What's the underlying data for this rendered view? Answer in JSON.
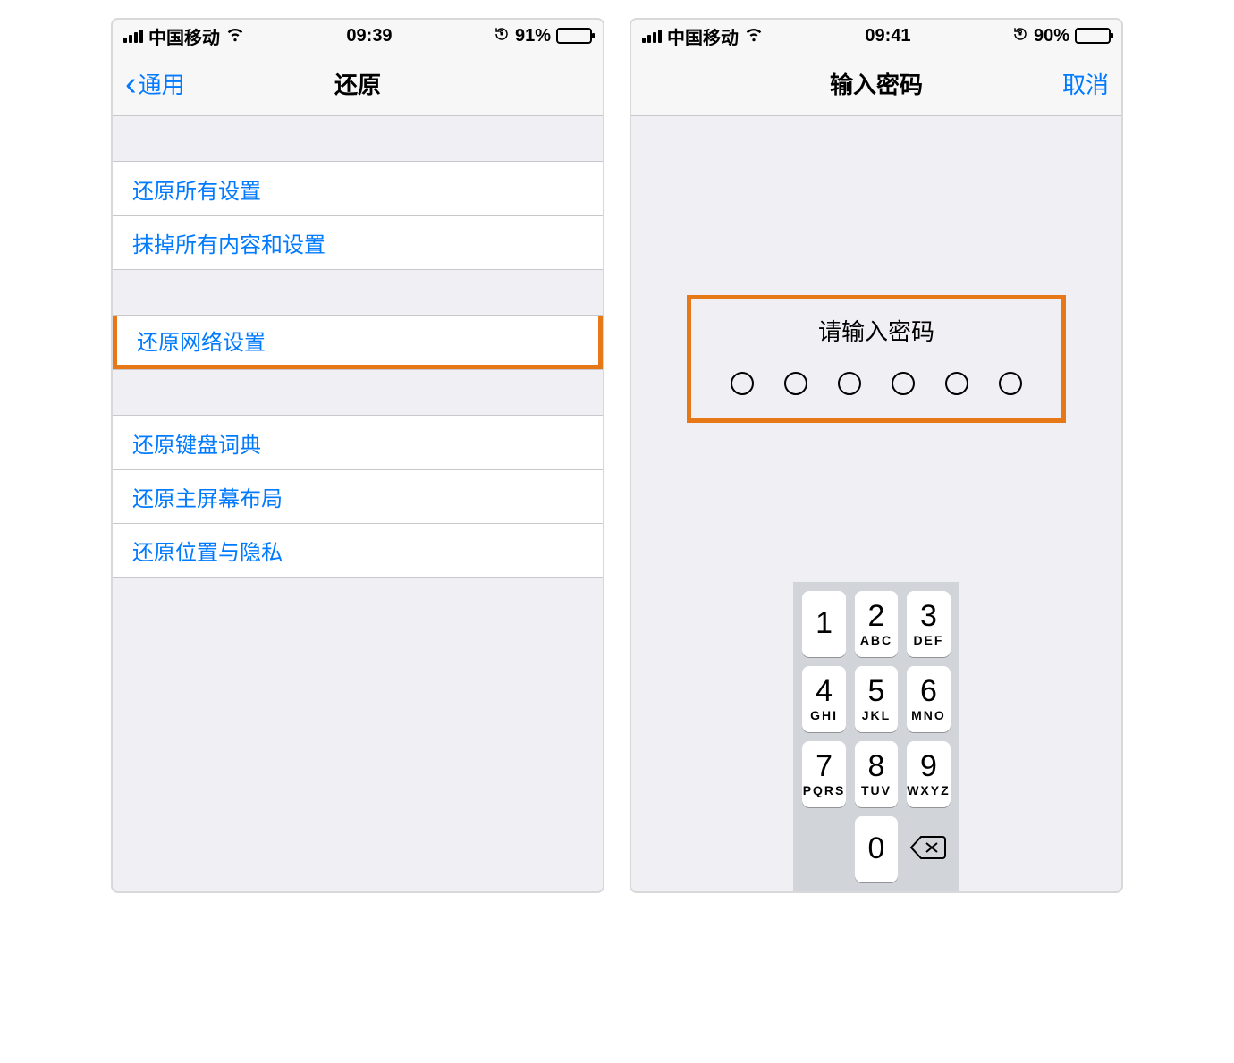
{
  "left": {
    "statusbar": {
      "carrier": "中国移动",
      "time": "09:39",
      "battery_pct": "91%",
      "battery_fill_width": "91%"
    },
    "nav": {
      "back_label": "通用",
      "title": "还原"
    },
    "groups": {
      "g1": [
        {
          "label": "还原所有设置"
        },
        {
          "label": "抹掉所有内容和设置"
        }
      ],
      "g2": [
        {
          "label": "还原网络设置",
          "highlighted": true
        }
      ],
      "g3": [
        {
          "label": "还原键盘词典"
        },
        {
          "label": "还原主屏幕布局"
        },
        {
          "label": "还原位置与隐私"
        }
      ]
    }
  },
  "right": {
    "statusbar": {
      "carrier": "中国移动",
      "time": "09:41",
      "battery_pct": "90%",
      "battery_fill_width": "90%"
    },
    "nav": {
      "title": "输入密码",
      "cancel": "取消"
    },
    "passcode": {
      "prompt": "请输入密码",
      "digits": 6
    },
    "keypad": {
      "k1": {
        "n": "1",
        "l": ""
      },
      "k2": {
        "n": "2",
        "l": "ABC"
      },
      "k3": {
        "n": "3",
        "l": "DEF"
      },
      "k4": {
        "n": "4",
        "l": "GHI"
      },
      "k5": {
        "n": "5",
        "l": "JKL"
      },
      "k6": {
        "n": "6",
        "l": "MNO"
      },
      "k7": {
        "n": "7",
        "l": "PQRS"
      },
      "k8": {
        "n": "8",
        "l": "TUV"
      },
      "k9": {
        "n": "9",
        "l": "WXYZ"
      },
      "k0": {
        "n": "0",
        "l": ""
      }
    }
  }
}
